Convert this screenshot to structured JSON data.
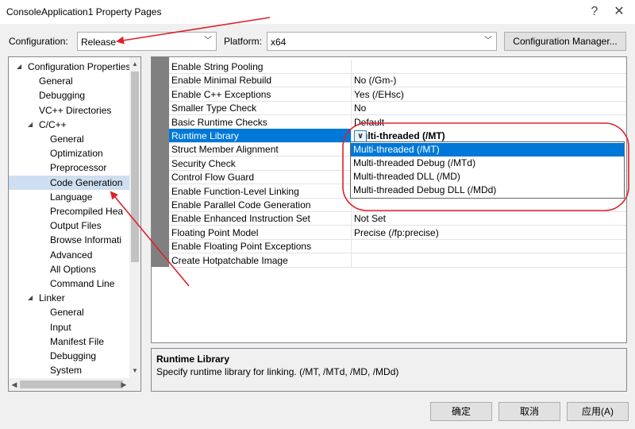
{
  "window": {
    "title": "ConsoleApplication1 Property Pages",
    "help_glyph": "?",
    "close_glyph": "✕"
  },
  "config_bar": {
    "configuration_label": "Configuration:",
    "configuration_value": "Release",
    "platform_label": "Platform:",
    "platform_value": "x64",
    "manager_button": "Configuration Manager..."
  },
  "tree": {
    "items": [
      {
        "label": "Configuration Properties",
        "level": 0,
        "expanded": true
      },
      {
        "label": "General",
        "level": 1
      },
      {
        "label": "Debugging",
        "level": 1
      },
      {
        "label": "VC++ Directories",
        "level": 1
      },
      {
        "label": "C/C++",
        "level": 1,
        "expanded": true
      },
      {
        "label": "General",
        "level": 2
      },
      {
        "label": "Optimization",
        "level": 2
      },
      {
        "label": "Preprocessor",
        "level": 2
      },
      {
        "label": "Code Generation",
        "level": 2,
        "selected": true
      },
      {
        "label": "Language",
        "level": 2
      },
      {
        "label": "Precompiled Hea",
        "level": 2
      },
      {
        "label": "Output Files",
        "level": 2
      },
      {
        "label": "Browse Informati",
        "level": 2
      },
      {
        "label": "Advanced",
        "level": 2
      },
      {
        "label": "All Options",
        "level": 2
      },
      {
        "label": "Command Line",
        "level": 2
      },
      {
        "label": "Linker",
        "level": 1,
        "expanded": true
      },
      {
        "label": "General",
        "level": 2
      },
      {
        "label": "Input",
        "level": 2
      },
      {
        "label": "Manifest File",
        "level": 2
      },
      {
        "label": "Debugging",
        "level": 2
      },
      {
        "label": "System",
        "level": 2
      }
    ]
  },
  "properties": [
    {
      "name": "Enable String Pooling",
      "value": ""
    },
    {
      "name": "Enable Minimal Rebuild",
      "value": "No (/Gm-)"
    },
    {
      "name": "Enable C++ Exceptions",
      "value": "Yes (/EHsc)"
    },
    {
      "name": "Smaller Type Check",
      "value": "No"
    },
    {
      "name": "Basic Runtime Checks",
      "value": "Default"
    },
    {
      "name": "Runtime Library",
      "value": "Multi-threaded (/MT)",
      "selected": true
    },
    {
      "name": "Struct Member Alignment",
      "value": ""
    },
    {
      "name": "Security Check",
      "value": ""
    },
    {
      "name": "Control Flow Guard",
      "value": ""
    },
    {
      "name": "Enable Function-Level Linking",
      "value": ""
    },
    {
      "name": "Enable Parallel Code Generation",
      "value": ""
    },
    {
      "name": "Enable Enhanced Instruction Set",
      "value": "Not Set"
    },
    {
      "name": "Floating Point Model",
      "value": "Precise (/fp:precise)"
    },
    {
      "name": "Enable Floating Point Exceptions",
      "value": ""
    },
    {
      "name": "Create Hotpatchable Image",
      "value": ""
    }
  ],
  "runtime_dropdown": {
    "options": [
      {
        "label": "Multi-threaded (/MT)",
        "selected": true
      },
      {
        "label": "Multi-threaded Debug (/MTd)"
      },
      {
        "label": "Multi-threaded DLL (/MD)"
      },
      {
        "label": "Multi-threaded Debug DLL (/MDd)"
      }
    ]
  },
  "description": {
    "title": "Runtime Library",
    "text": "Specify runtime library for linking.     (/MT, /MTd, /MD, /MDd)"
  },
  "buttons": {
    "ok": "确定",
    "cancel": "取消",
    "apply": "应用(A)"
  },
  "colors": {
    "selection": "#0078d7",
    "tree_selection": "#cfdff1",
    "annotation": "#e0202a"
  }
}
